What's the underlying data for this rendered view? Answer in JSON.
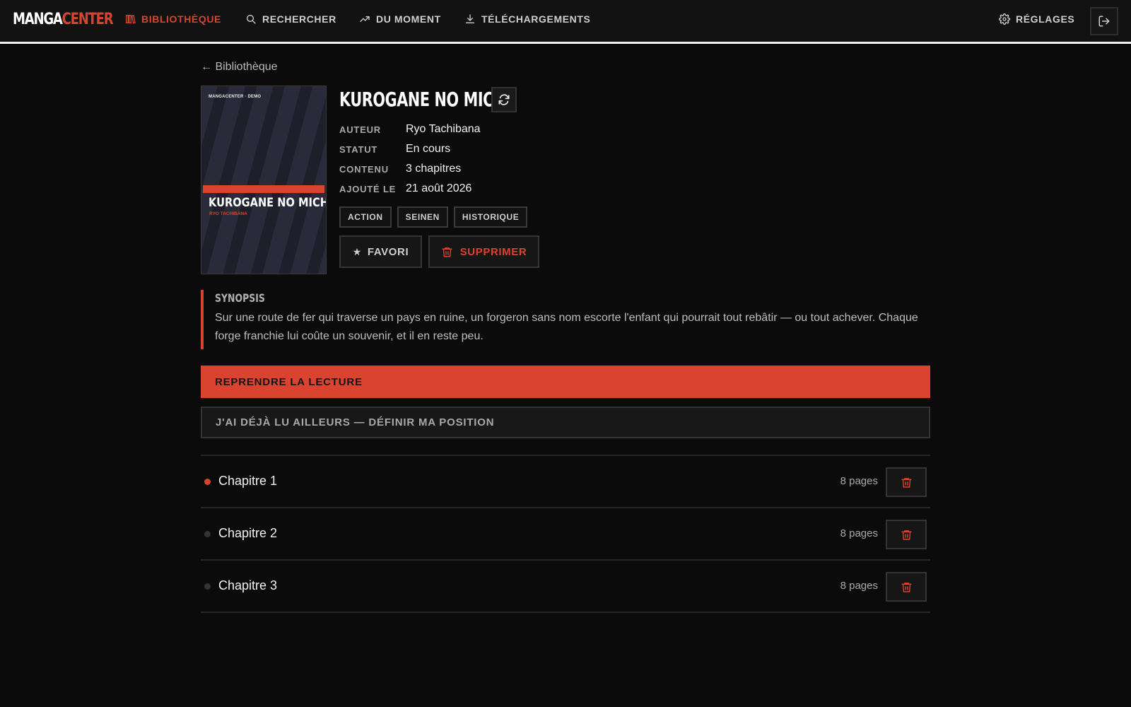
{
  "brand": {
    "part1": "MANGA",
    "part2": "CENTER"
  },
  "nav": {
    "library": "BIBLIOTHÈQUE",
    "search": "RECHERCHER",
    "trending": "DU MOMENT",
    "downloads": "TÉLÉCHARGEMENTS",
    "settings": "RÉGLAGES"
  },
  "back_link": "← Bibliothèque",
  "cover": {
    "tag": "MANGACENTER · DEMO",
    "title": "KUROGANE NO MICHI",
    "author": "RYO TACHIBANA"
  },
  "manga": {
    "title": "KUROGANE NO MICHI",
    "meta": {
      "author_label": "AUTEUR",
      "author": "Ryo Tachibana",
      "status_label": "STATUT",
      "status": "En cours",
      "content_label": "CONTENU",
      "content": "3 chapitres",
      "added_label": "AJOUTÉ LE",
      "added": "21 août 2026"
    },
    "genres": [
      "ACTION",
      "SEINEN",
      "HISTORIQUE"
    ]
  },
  "actions": {
    "favorite": "FAVORI",
    "delete": "SUPPRIMER"
  },
  "synopsis": {
    "heading": "SYNOPSIS",
    "text": "Sur une route de fer qui traverse un pays en ruine, un forgeron sans nom escorte l'enfant qui pourrait tout rebâtir — ou tout achever. Chaque forge franchie lui coûte un souvenir, et il en reste peu."
  },
  "resume_button": "REPRENDRE LA LECTURE",
  "already_read_button": "J'AI DÉJÀ LU AILLEURS — DÉFINIR MA POSITION",
  "chapters": [
    {
      "name": "Chapitre 1",
      "pages": "8 pages",
      "current": true
    },
    {
      "name": "Chapitre 2",
      "pages": "8 pages",
      "current": false
    },
    {
      "name": "Chapitre 3",
      "pages": "8 pages",
      "current": false
    }
  ],
  "colors": {
    "accent": "#d9432f",
    "background": "#0b0b0b",
    "nav_bg": "#121212"
  },
  "icons": {
    "library": "library-icon",
    "search": "search-icon",
    "trending": "trending-icon",
    "downloads": "download-icon",
    "settings": "gear-icon",
    "logout": "logout-icon",
    "refresh": "refresh-icon",
    "favorite": "star-icon",
    "delete": "trash-icon"
  }
}
